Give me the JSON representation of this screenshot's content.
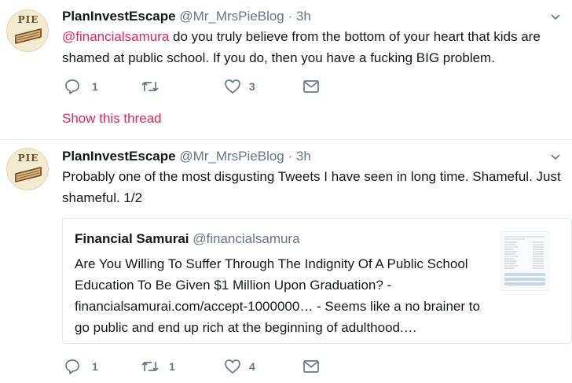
{
  "tweets": [
    {
      "name": "PlanInvestEscape",
      "handle": "@Mr_MrsPieBlog",
      "separator": "·",
      "time": "3h",
      "avatar_text": "PIE",
      "mention": "@financialsamura",
      "text": " do you truly believe from the bottom of your heart that kids are shamed at public school. If you do, then you have a fucking BIG problem.",
      "replies": "1",
      "retweets": "",
      "likes": "3",
      "show_thread": "Show this thread"
    },
    {
      "name": "PlanInvestEscape",
      "handle": "@Mr_MrsPieBlog",
      "separator": "·",
      "time": "3h",
      "avatar_text": "PIE",
      "text": "Probably one of the most disgusting Tweets I have seen in long time. Shameful. Just shameful. 1/2",
      "quoted": {
        "name": "Financial Samurai",
        "handle": "@financialsamura",
        "text": "Are You Willing To Suffer Through The Indignity Of A Public School Education To Be Given $1 Million Upon Graduation? - financialsamurai.com/accept-1000000… - Seems like a no brainer to go public and end up rich at the beginning of adulthood.…"
      },
      "replies": "1",
      "retweets": "1",
      "likes": "4"
    }
  ],
  "colors": {
    "text": "#14171a",
    "secondary": "#657786",
    "mention": "#e0245e",
    "divider": "#e6ecf0"
  },
  "icons": [
    "reply-icon",
    "retweet-icon",
    "like-icon",
    "message-icon",
    "chevron-down-icon"
  ]
}
